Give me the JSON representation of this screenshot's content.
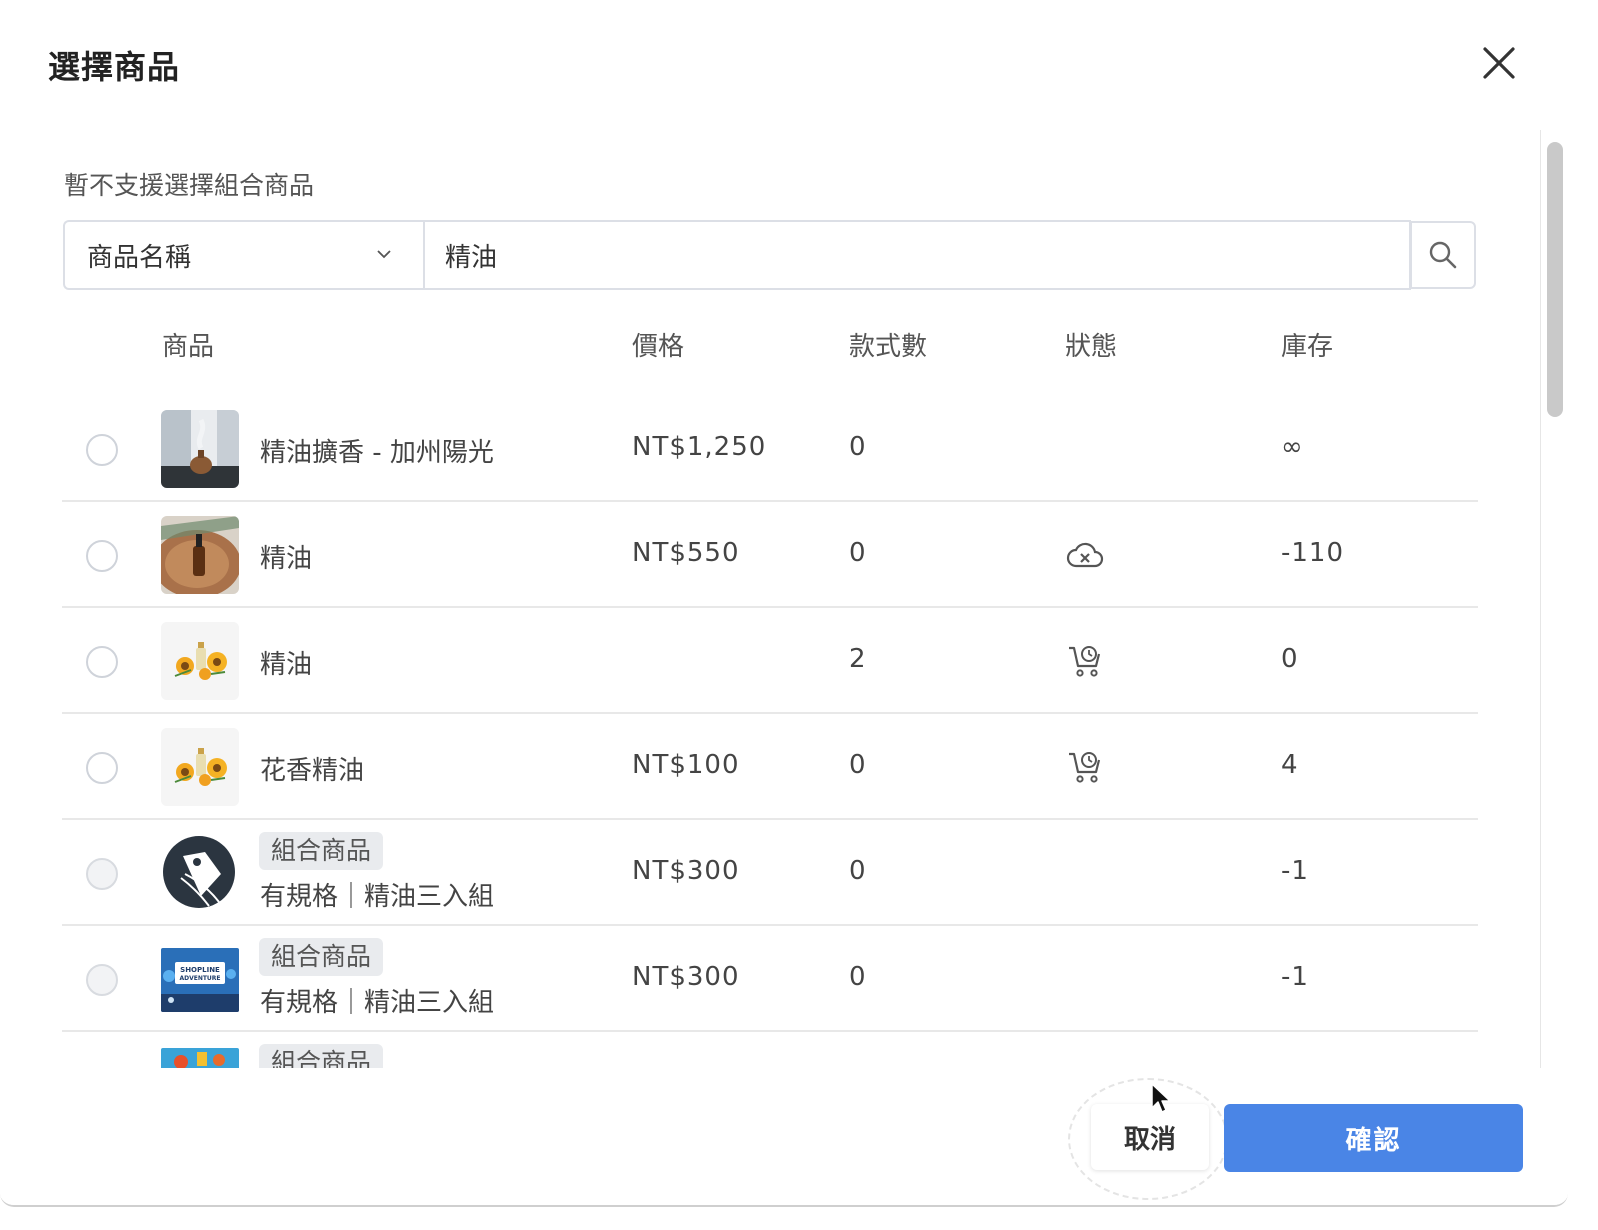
{
  "dialog": {
    "title": "選擇商品",
    "notice": "暫不支援選擇組合商品"
  },
  "search": {
    "field_selected": "商品名稱",
    "query": "精油"
  },
  "table": {
    "headers": {
      "product": "商品",
      "price": "價格",
      "variants": "款式數",
      "status": "狀態",
      "stock": "庫存"
    },
    "rows": [
      {
        "name": "精油擴香 - 加州陽光",
        "price": "NT$1,250",
        "variants": "0",
        "status_icon": "",
        "stock": "∞",
        "selectable": true,
        "thumb": "diffuser-photo"
      },
      {
        "name": "精油",
        "price": "NT$550",
        "variants": "0",
        "status_icon": "cloud-x-icon",
        "stock": "-110",
        "selectable": true,
        "thumb": "oil-bottle-photo"
      },
      {
        "name": "精油",
        "price": "",
        "variants": "2",
        "status_icon": "cart-clock-icon",
        "stock": "0",
        "selectable": true,
        "thumb": "sunflower-oil-photo"
      },
      {
        "name": "花香精油",
        "price": "NT$100",
        "variants": "0",
        "status_icon": "cart-clock-icon",
        "stock": "4",
        "selectable": true,
        "thumb": "sunflower-oil-photo"
      },
      {
        "tag": "組合商品",
        "name": "有規格｜精油三入組",
        "price": "NT$300",
        "variants": "0",
        "status_icon": "",
        "stock": "-1",
        "selectable": false,
        "thumb": "tag-logo"
      },
      {
        "tag": "組合商品",
        "name": "有規格｜精油三入組",
        "price": "NT$300",
        "variants": "0",
        "status_icon": "",
        "stock": "-1",
        "selectable": false,
        "thumb": "shopline-adventure-banner"
      },
      {
        "tag": "組合商品",
        "name": "",
        "price": "",
        "variants": "",
        "status_icon": "",
        "stock": "",
        "selectable": false,
        "thumb": "colorful-banner"
      }
    ]
  },
  "thumb_text": {
    "shopline_line1": "SHOPLINE",
    "shopline_line2": "ADVENTURE"
  },
  "footer": {
    "cancel_label": "取消",
    "confirm_label": "確認"
  },
  "colors": {
    "primary": "#4a85e6",
    "border": "#dcdfe6",
    "text": "#444444"
  }
}
